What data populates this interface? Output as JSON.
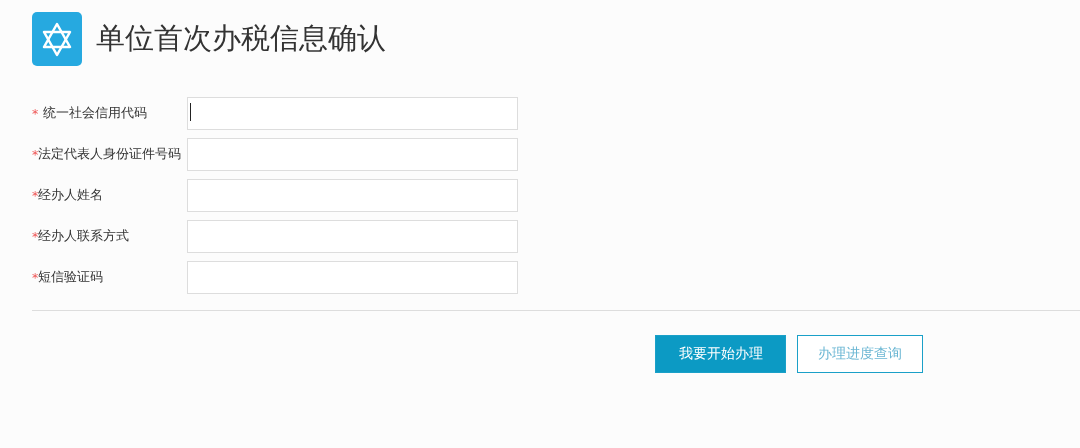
{
  "title": "单位首次办税信息确认",
  "fields": [
    {
      "mark": "*",
      "label": "统一社会信用代码",
      "spaced": true,
      "focused": true
    },
    {
      "mark": "*",
      "label": "法定代表人身份证件号码",
      "spaced": false,
      "focused": false
    },
    {
      "mark": "*",
      "label": "经办人姓名",
      "spaced": false,
      "focused": false
    },
    {
      "mark": "*",
      "label": "经办人联系方式",
      "spaced": false,
      "focused": false
    },
    {
      "mark": "*",
      "label": "短信验证码",
      "spaced": false,
      "focused": false
    }
  ],
  "buttons": [
    {
      "label": "我要开始办理",
      "kind": "primary"
    },
    {
      "label": "办理进度查询",
      "kind": "secondary"
    }
  ]
}
